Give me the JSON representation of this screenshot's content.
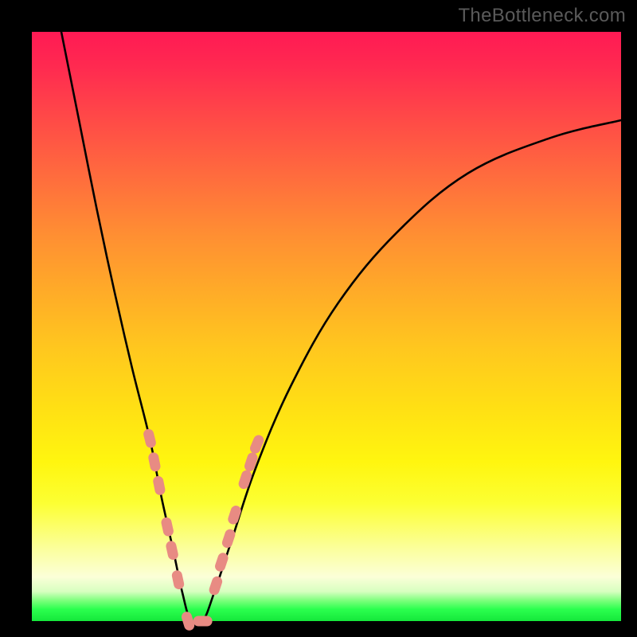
{
  "watermark": "TheBottleneck.com",
  "colors": {
    "background": "#000000",
    "curve": "#000000",
    "dot_fill": "#e88b83",
    "dot_stroke": "#d96a60"
  },
  "chart_data": {
    "type": "line",
    "title": "",
    "xlabel": "",
    "ylabel": "",
    "xlim": [
      0,
      100
    ],
    "ylim": [
      0,
      100
    ],
    "notes": "V-shaped bottleneck curve. Y is mismatch percentage (0 at bottom = green = ideal, 100 at top = red = severe bottleneck). X is relative component balance. No axis ticks or numeric labels are rendered; values below are estimates read from the curve shape against the gradient bands.",
    "series": [
      {
        "name": "bottleneck-curve",
        "x": [
          5,
          8,
          11,
          14,
          17,
          20,
          22,
          24,
          25.5,
          27,
          29,
          31,
          34,
          38,
          44,
          52,
          62,
          74,
          88,
          100
        ],
        "y": [
          100,
          85,
          70,
          56,
          43,
          31,
          21,
          12,
          5,
          0,
          0,
          5,
          14,
          26,
          40,
          54,
          66,
          76,
          82,
          85
        ]
      }
    ],
    "markers": {
      "name": "highlight-dots",
      "note": "Salmon capsule-shaped markers clustered on both arms of the V near the green zone and a pair at the trough.",
      "points": [
        {
          "x": 20.0,
          "y": 31
        },
        {
          "x": 20.8,
          "y": 27
        },
        {
          "x": 21.6,
          "y": 23
        },
        {
          "x": 23.0,
          "y": 16
        },
        {
          "x": 23.8,
          "y": 12
        },
        {
          "x": 24.8,
          "y": 7
        },
        {
          "x": 26.5,
          "y": 0
        },
        {
          "x": 29.0,
          "y": 0
        },
        {
          "x": 31.2,
          "y": 6
        },
        {
          "x": 32.2,
          "y": 10
        },
        {
          "x": 33.4,
          "y": 14
        },
        {
          "x": 34.4,
          "y": 18
        },
        {
          "x": 36.2,
          "y": 24
        },
        {
          "x": 37.2,
          "y": 27
        },
        {
          "x": 38.2,
          "y": 30
        }
      ]
    }
  }
}
